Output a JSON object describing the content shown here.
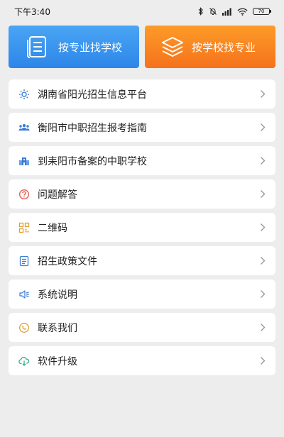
{
  "status_bar": {
    "time": "下午3:40",
    "battery": "70"
  },
  "top_buttons": {
    "by_major": "按专业找学校",
    "by_school": "按学校找专业"
  },
  "menu": [
    {
      "label": "湖南省阳光招生信息平台",
      "icon": "sun-icon",
      "color": "#3a7bd5"
    },
    {
      "label": "衡阳市中职招生报考指南",
      "icon": "people-icon",
      "color": "#3a7bd5"
    },
    {
      "label": "到耒阳市备案的中职学校",
      "icon": "school-icon",
      "color": "#3a7bd5"
    },
    {
      "label": "问题解答",
      "icon": "question-icon",
      "color": "#e06050"
    },
    {
      "label": "二维码",
      "icon": "qrcode-icon",
      "color": "#e0a030"
    },
    {
      "label": "招生政策文件",
      "icon": "document-icon",
      "color": "#3a7bd5"
    },
    {
      "label": "系统说明",
      "icon": "speaker-icon",
      "color": "#3a7bd5"
    },
    {
      "label": "联系我们",
      "icon": "contact-icon",
      "color": "#e0a030"
    },
    {
      "label": "软件升级",
      "icon": "cloud-download-icon",
      "color": "#30b080"
    }
  ],
  "colors": {
    "blue": "#2d86e8",
    "orange": "#f5721c",
    "background": "#ededed"
  }
}
